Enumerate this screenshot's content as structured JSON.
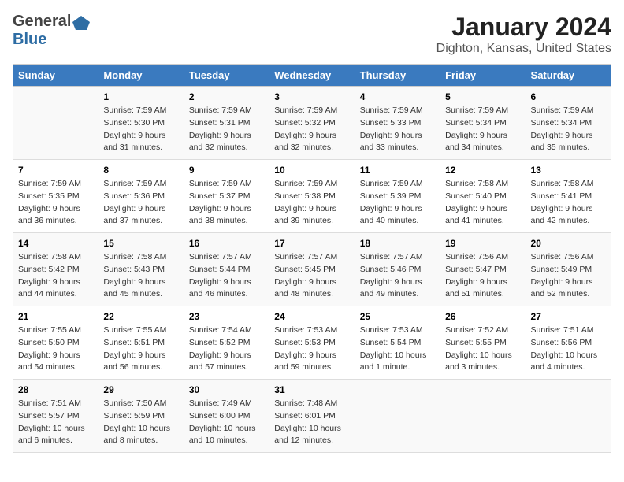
{
  "brand": {
    "name_part1": "General",
    "name_part2": "Blue"
  },
  "calendar": {
    "title": "January 2024",
    "subtitle": "Dighton, Kansas, United States",
    "days_of_week": [
      "Sunday",
      "Monday",
      "Tuesday",
      "Wednesday",
      "Thursday",
      "Friday",
      "Saturday"
    ],
    "weeks": [
      [
        {
          "day": "",
          "info": ""
        },
        {
          "day": "1",
          "info": "Sunrise: 7:59 AM\nSunset: 5:30 PM\nDaylight: 9 hours\nand 31 minutes."
        },
        {
          "day": "2",
          "info": "Sunrise: 7:59 AM\nSunset: 5:31 PM\nDaylight: 9 hours\nand 32 minutes."
        },
        {
          "day": "3",
          "info": "Sunrise: 7:59 AM\nSunset: 5:32 PM\nDaylight: 9 hours\nand 32 minutes."
        },
        {
          "day": "4",
          "info": "Sunrise: 7:59 AM\nSunset: 5:33 PM\nDaylight: 9 hours\nand 33 minutes."
        },
        {
          "day": "5",
          "info": "Sunrise: 7:59 AM\nSunset: 5:34 PM\nDaylight: 9 hours\nand 34 minutes."
        },
        {
          "day": "6",
          "info": "Sunrise: 7:59 AM\nSunset: 5:34 PM\nDaylight: 9 hours\nand 35 minutes."
        }
      ],
      [
        {
          "day": "7",
          "info": "Sunrise: 7:59 AM\nSunset: 5:35 PM\nDaylight: 9 hours\nand 36 minutes."
        },
        {
          "day": "8",
          "info": "Sunrise: 7:59 AM\nSunset: 5:36 PM\nDaylight: 9 hours\nand 37 minutes."
        },
        {
          "day": "9",
          "info": "Sunrise: 7:59 AM\nSunset: 5:37 PM\nDaylight: 9 hours\nand 38 minutes."
        },
        {
          "day": "10",
          "info": "Sunrise: 7:59 AM\nSunset: 5:38 PM\nDaylight: 9 hours\nand 39 minutes."
        },
        {
          "day": "11",
          "info": "Sunrise: 7:59 AM\nSunset: 5:39 PM\nDaylight: 9 hours\nand 40 minutes."
        },
        {
          "day": "12",
          "info": "Sunrise: 7:58 AM\nSunset: 5:40 PM\nDaylight: 9 hours\nand 41 minutes."
        },
        {
          "day": "13",
          "info": "Sunrise: 7:58 AM\nSunset: 5:41 PM\nDaylight: 9 hours\nand 42 minutes."
        }
      ],
      [
        {
          "day": "14",
          "info": "Sunrise: 7:58 AM\nSunset: 5:42 PM\nDaylight: 9 hours\nand 44 minutes."
        },
        {
          "day": "15",
          "info": "Sunrise: 7:58 AM\nSunset: 5:43 PM\nDaylight: 9 hours\nand 45 minutes."
        },
        {
          "day": "16",
          "info": "Sunrise: 7:57 AM\nSunset: 5:44 PM\nDaylight: 9 hours\nand 46 minutes."
        },
        {
          "day": "17",
          "info": "Sunrise: 7:57 AM\nSunset: 5:45 PM\nDaylight: 9 hours\nand 48 minutes."
        },
        {
          "day": "18",
          "info": "Sunrise: 7:57 AM\nSunset: 5:46 PM\nDaylight: 9 hours\nand 49 minutes."
        },
        {
          "day": "19",
          "info": "Sunrise: 7:56 AM\nSunset: 5:47 PM\nDaylight: 9 hours\nand 51 minutes."
        },
        {
          "day": "20",
          "info": "Sunrise: 7:56 AM\nSunset: 5:49 PM\nDaylight: 9 hours\nand 52 minutes."
        }
      ],
      [
        {
          "day": "21",
          "info": "Sunrise: 7:55 AM\nSunset: 5:50 PM\nDaylight: 9 hours\nand 54 minutes."
        },
        {
          "day": "22",
          "info": "Sunrise: 7:55 AM\nSunset: 5:51 PM\nDaylight: 9 hours\nand 56 minutes."
        },
        {
          "day": "23",
          "info": "Sunrise: 7:54 AM\nSunset: 5:52 PM\nDaylight: 9 hours\nand 57 minutes."
        },
        {
          "day": "24",
          "info": "Sunrise: 7:53 AM\nSunset: 5:53 PM\nDaylight: 9 hours\nand 59 minutes."
        },
        {
          "day": "25",
          "info": "Sunrise: 7:53 AM\nSunset: 5:54 PM\nDaylight: 10 hours\nand 1 minute."
        },
        {
          "day": "26",
          "info": "Sunrise: 7:52 AM\nSunset: 5:55 PM\nDaylight: 10 hours\nand 3 minutes."
        },
        {
          "day": "27",
          "info": "Sunrise: 7:51 AM\nSunset: 5:56 PM\nDaylight: 10 hours\nand 4 minutes."
        }
      ],
      [
        {
          "day": "28",
          "info": "Sunrise: 7:51 AM\nSunset: 5:57 PM\nDaylight: 10 hours\nand 6 minutes."
        },
        {
          "day": "29",
          "info": "Sunrise: 7:50 AM\nSunset: 5:59 PM\nDaylight: 10 hours\nand 8 minutes."
        },
        {
          "day": "30",
          "info": "Sunrise: 7:49 AM\nSunset: 6:00 PM\nDaylight: 10 hours\nand 10 minutes."
        },
        {
          "day": "31",
          "info": "Sunrise: 7:48 AM\nSunset: 6:01 PM\nDaylight: 10 hours\nand 12 minutes."
        },
        {
          "day": "",
          "info": ""
        },
        {
          "day": "",
          "info": ""
        },
        {
          "day": "",
          "info": ""
        }
      ]
    ]
  }
}
